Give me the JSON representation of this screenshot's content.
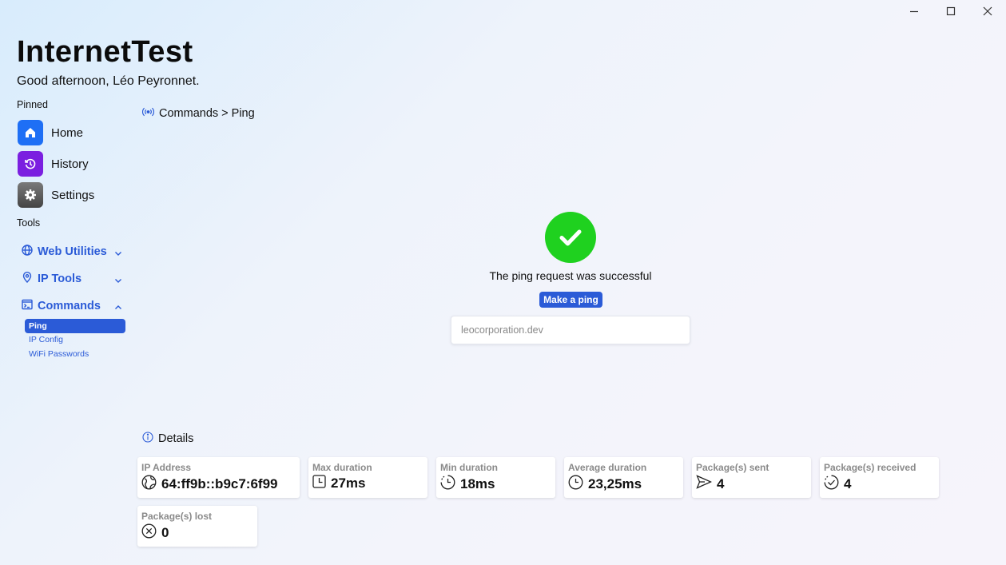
{
  "app": {
    "title": "InternetTest",
    "greeting": "Good afternoon, Léo Peyronnet."
  },
  "window_controls": [
    "minimize-icon",
    "maximize-icon",
    "close-icon"
  ],
  "sidebar": {
    "pinned_label": "Pinned",
    "pinned": [
      {
        "label": "Home",
        "icon": "home-icon",
        "color": "#1e6ff5"
      },
      {
        "label": "History",
        "icon": "history-icon",
        "color": "#7b1fe0"
      },
      {
        "label": "Settings",
        "icon": "gear-icon",
        "color": "#555555"
      }
    ],
    "tools_label": "Tools",
    "tools": [
      {
        "label": "Web Utilities",
        "icon": "globe-icon",
        "expanded": false
      },
      {
        "label": "IP Tools",
        "icon": "location-pin-icon",
        "expanded": false
      },
      {
        "label": "Commands",
        "icon": "command-window-icon",
        "expanded": true
      }
    ],
    "commands_items": [
      {
        "label": "Ping",
        "active": true
      },
      {
        "label": "IP Config",
        "active": false
      },
      {
        "label": "WiFi Passwords",
        "active": false
      }
    ]
  },
  "breadcrumb": {
    "icon": "broadcast-icon",
    "text": "Commands > Ping"
  },
  "ping": {
    "status_icon": "checkmark-circle-icon",
    "status_color": "#1fd11f",
    "status_message": "The ping request was successful",
    "button_label": "Make a ping",
    "input_value": "leocorporation.dev"
  },
  "details": {
    "heading": "Details",
    "heading_icon": "info-icon",
    "cards": [
      {
        "label": "IP Address",
        "value": "64:ff9b::b9c7:6f99",
        "icon": "globe-network-icon"
      },
      {
        "label": "Max duration",
        "value": "27ms",
        "icon": "clock-square-icon"
      },
      {
        "label": "Min duration",
        "value": "18ms",
        "icon": "clock-dashed-icon"
      },
      {
        "label": "Average duration",
        "value": "23,25ms",
        "icon": "clock-icon"
      },
      {
        "label": "Package(s) sent",
        "value": "4",
        "icon": "send-icon"
      },
      {
        "label": "Package(s) received",
        "value": "4",
        "icon": "received-check-icon"
      },
      {
        "label": "Package(s) lost",
        "value": "0",
        "icon": "x-circle-icon"
      }
    ]
  },
  "accent_color": "#2b5bd7"
}
